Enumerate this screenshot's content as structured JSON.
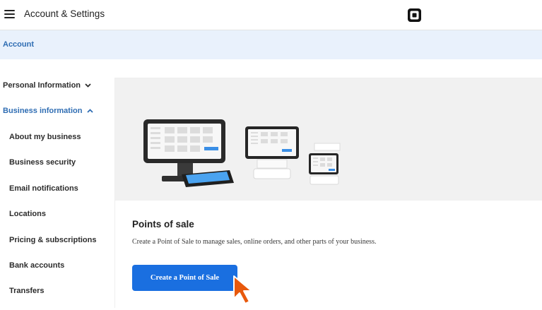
{
  "header": {
    "menu_icon": "hamburger-menu-icon",
    "title": "Account & Settings",
    "logo_icon": "square-logo-icon"
  },
  "breadcrumb": {
    "label": "Account"
  },
  "sidebar": {
    "items": [
      {
        "label": "Personal Information",
        "chevron": "chevron-down-icon"
      },
      {
        "label": "Business information",
        "chevron": "chevron-up-icon",
        "active": true
      },
      {
        "label": "About my business"
      },
      {
        "label": "Business security"
      },
      {
        "label": "Email notifications"
      },
      {
        "label": "Locations"
      },
      {
        "label": "Pricing & subscriptions"
      },
      {
        "label": "Bank accounts"
      },
      {
        "label": "Transfers"
      }
    ]
  },
  "main": {
    "section_title": "Points of sale",
    "description": "Create a Point of Sale to manage sales, online orders, and other parts of your business.",
    "cta_label": "Create a Point of Sale",
    "hero_icon": "pos-devices-illustration"
  },
  "colors": {
    "accent": "#1a6fe0",
    "link": "#2f6db3",
    "breadcrumb_bg": "#e9f1fc",
    "hero_bg": "#f1f1f1",
    "cursor": "#e8590c"
  }
}
